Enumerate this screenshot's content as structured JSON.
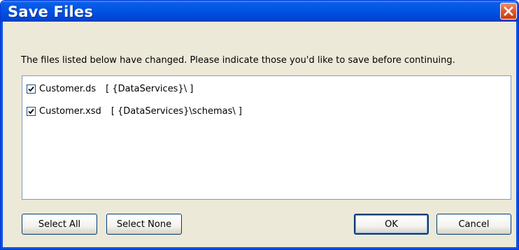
{
  "dialog": {
    "title": "Save Files",
    "message": "The files listed below have changed. Please indicate those you'd like to save before continuing."
  },
  "files": [
    {
      "name": "Customer.ds",
      "path": "[ {DataServices}\\ ]",
      "checked": true
    },
    {
      "name": "Customer.xsd",
      "path": "[ {DataServices}\\schemas\\ ]",
      "checked": true
    }
  ],
  "buttons": {
    "select_all": "Select All",
    "select_none": "Select None",
    "ok": "OK",
    "cancel": "Cancel"
  },
  "colors": {
    "titlebar": "#0054e3",
    "close_button": "#e35a2b",
    "dialog_bg": "#ece9d8"
  },
  "icons": {
    "close": "close-icon",
    "check": "checkmark-icon"
  }
}
